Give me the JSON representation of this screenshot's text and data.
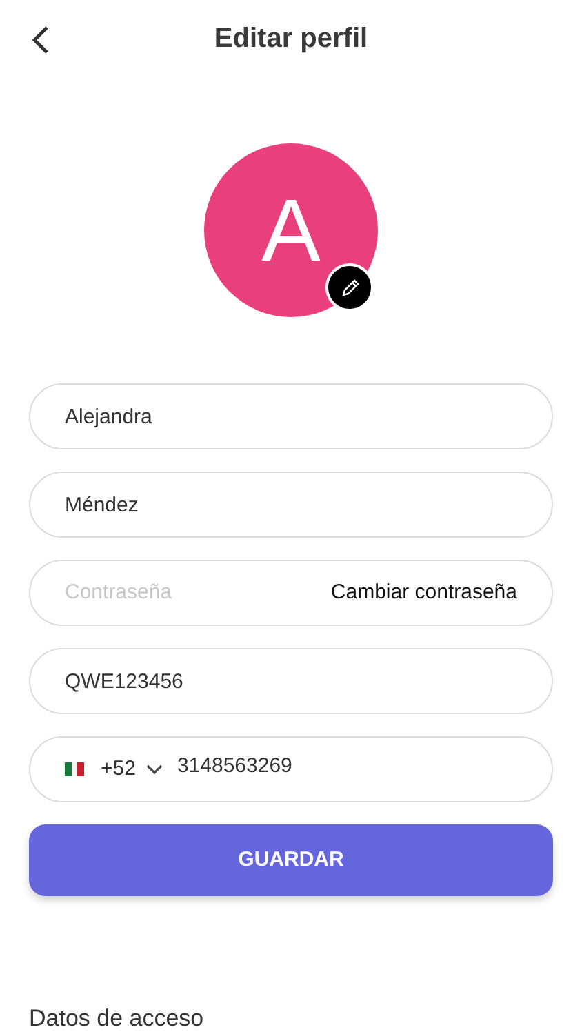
{
  "header": {
    "title": "Editar perfil"
  },
  "avatar": {
    "initial": "A",
    "color": "#e93f7b"
  },
  "fields": [
    {
      "kind": "text",
      "value": "Alejandra"
    },
    {
      "kind": "text",
      "value": "Méndez"
    },
    {
      "kind": "password",
      "placeholder": "Contraseña",
      "action": "Cambiar contraseña"
    },
    {
      "kind": "text",
      "value": "QWE123456"
    },
    {
      "kind": "phone",
      "code": "+52",
      "value": "3148563269"
    }
  ],
  "save_button": "GUARDAR",
  "section_title": "Datos de acceso"
}
